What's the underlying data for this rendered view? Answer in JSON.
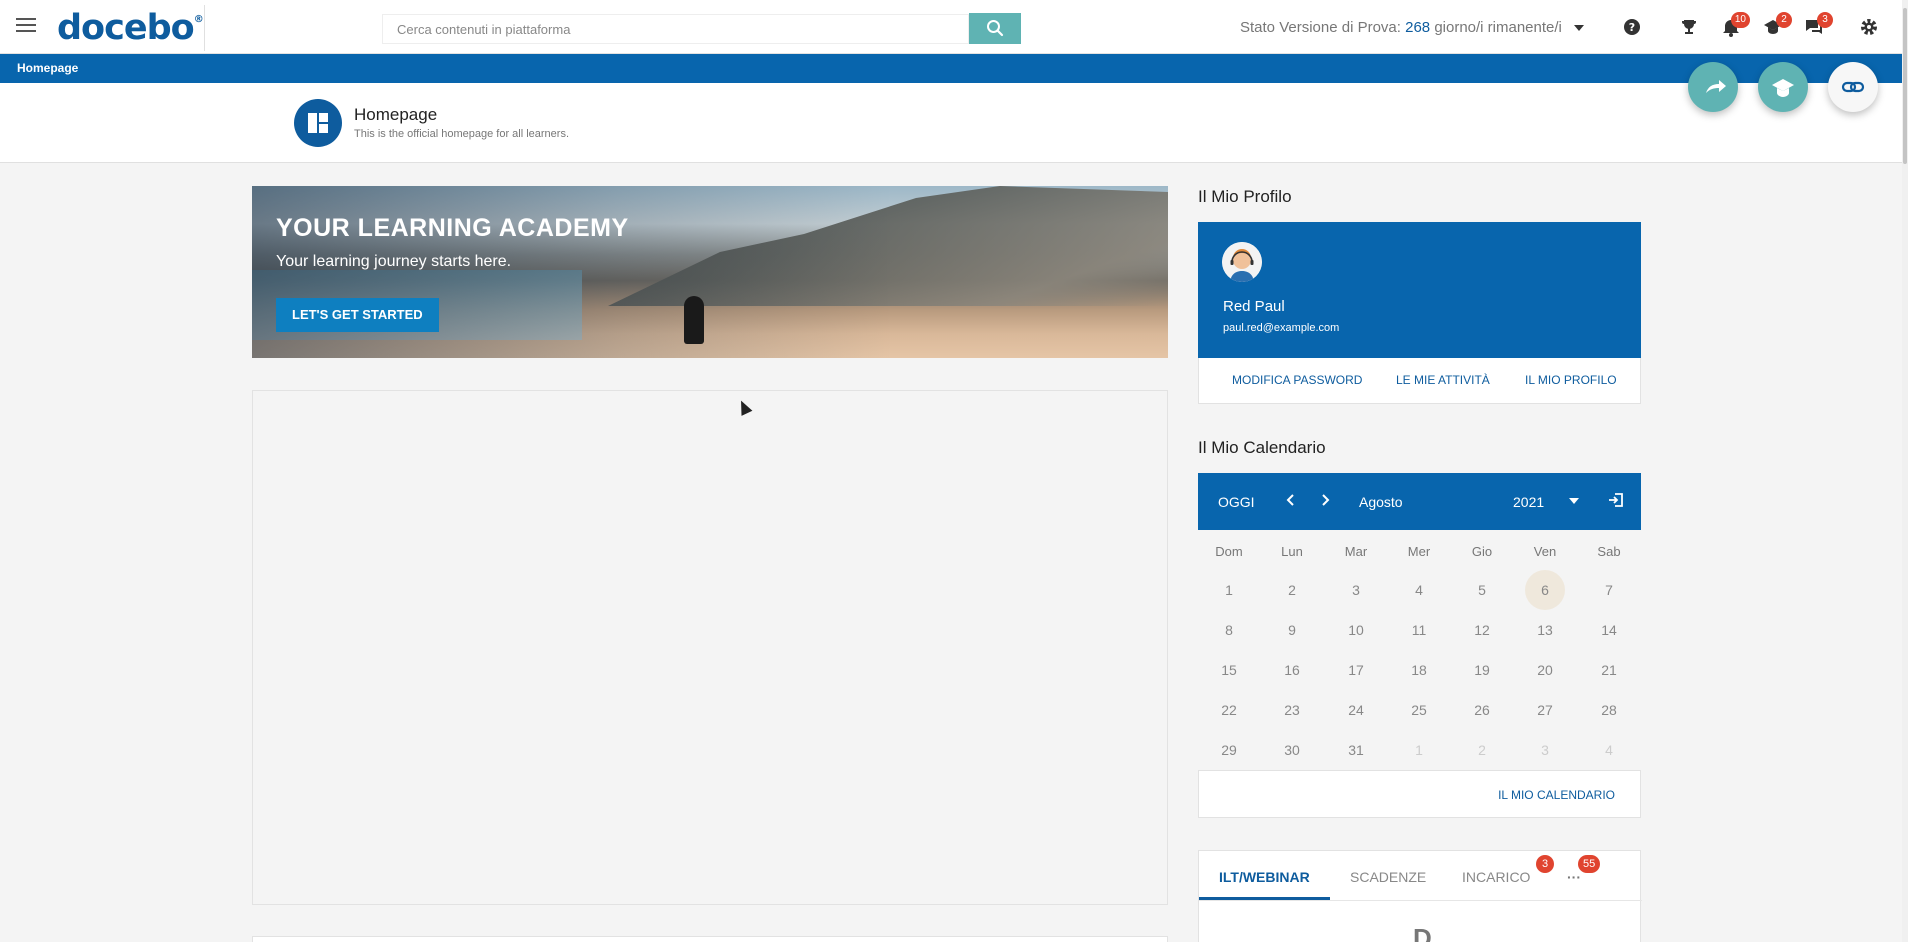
{
  "topbar": {
    "logo_text": "docebo",
    "logo_mark": "®",
    "search_placeholder": "Cerca contenuti in piattaforma",
    "trial_label": "Stato Versione di Prova:",
    "trial_days": "268",
    "trial_suffix": "giorno/i rimanente/i",
    "icons": [
      "menu-icon",
      "search-icon",
      "help-icon",
      "trophy-icon",
      "bell-icon",
      "graduation-cap-icon",
      "chat-icon",
      "gear-icon"
    ],
    "badges": {
      "notifications": "10",
      "courses": "2",
      "messages": "3"
    }
  },
  "breadcrumb": {
    "current": "Homepage"
  },
  "page_header": {
    "title": "Homepage",
    "subtitle": "This is the official homepage for all learners."
  },
  "fab_icons": [
    "share-icon",
    "graduation-cap-icon",
    "link-icon"
  ],
  "banner": {
    "title": "YOUR LEARNING ACADEMY",
    "subtitle": "Your learning journey starts here.",
    "cta": "LET'S GET STARTED"
  },
  "profile": {
    "heading": "Il Mio Profilo",
    "name": "Red Paul",
    "email": "paul.red@example.com",
    "links": [
      "MODIFICA PASSWORD",
      "LE MIE ATTIVITÀ",
      "IL MIO PROFILO"
    ]
  },
  "calendar": {
    "heading": "Il Mio Calendario",
    "today_label": "OGGI",
    "month": "Agosto",
    "year": "2021",
    "weekdays": [
      "Dom",
      "Lun",
      "Mar",
      "Mer",
      "Gio",
      "Ven",
      "Sab"
    ],
    "weeks": [
      [
        "1",
        "2",
        "3",
        "4",
        "5",
        "6",
        "7"
      ],
      [
        "8",
        "9",
        "10",
        "11",
        "12",
        "13",
        "14"
      ],
      [
        "15",
        "16",
        "17",
        "18",
        "19",
        "20",
        "21"
      ],
      [
        "22",
        "23",
        "24",
        "25",
        "26",
        "27",
        "28"
      ],
      [
        "29",
        "30",
        "31",
        "1",
        "2",
        "3",
        "4"
      ]
    ],
    "today": "6",
    "footer_link": "IL MIO CALENDARIO"
  },
  "tabs": {
    "items": [
      {
        "label": "ILT/WEBINAR",
        "active": true
      },
      {
        "label": "SCADENZE",
        "active": false
      },
      {
        "label": "INCARICO",
        "active": false,
        "badge": "3"
      },
      {
        "label": "···",
        "active": false,
        "badge": "55"
      }
    ],
    "content_peek": "D"
  },
  "colors": {
    "primary": "#0865ad",
    "accent": "#5fb3b3",
    "badge": "#e0442f"
  }
}
